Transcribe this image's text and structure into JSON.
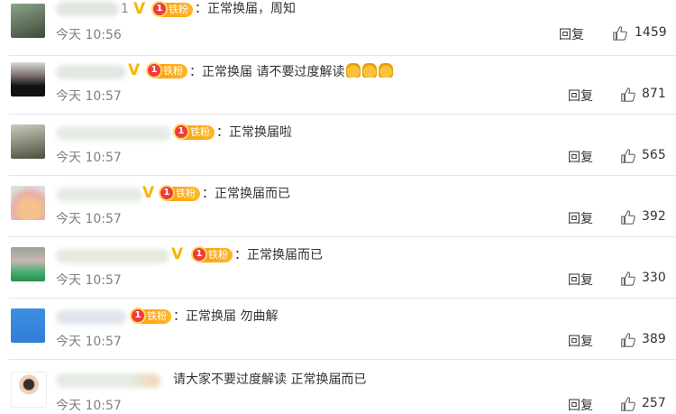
{
  "comments": [
    {
      "text": "：正常换届，周知",
      "time": "今天 10:56",
      "reply": "回复",
      "likes": "1459",
      "fan_badge": "铁粉",
      "level": "1",
      "name_suffix": "1",
      "verified": "V"
    },
    {
      "text": "：正常换届 请不要过度解读",
      "time": "今天 10:57",
      "reply": "回复",
      "likes": "871",
      "fan_badge": "铁粉",
      "level": "1",
      "verified": "V",
      "emoji_count": 3
    },
    {
      "text": "：正常换届啦",
      "time": "今天 10:57",
      "reply": "回复",
      "likes": "565",
      "fan_badge": "铁粉",
      "level": "1"
    },
    {
      "text": "：正常换届而已",
      "time": "今天 10:57",
      "reply": "回复",
      "likes": "392",
      "fan_badge": "铁粉",
      "level": "1",
      "verified": "V"
    },
    {
      "text": "：正常换届而已",
      "time": "今天 10:57",
      "reply": "回复",
      "likes": "330",
      "fan_badge": "铁粉",
      "level": "1",
      "verified": "V"
    },
    {
      "text": "：正常换届 勿曲解",
      "time": "今天 10:57",
      "reply": "回复",
      "likes": "389",
      "fan_badge": "铁粉",
      "level": "1"
    },
    {
      "text": "请大家不要过度解读 正常换届而已",
      "time": "今天 10:57",
      "reply": "回复",
      "likes": "257"
    }
  ],
  "icons": {
    "like": "thumbs-up-icon",
    "emoji": "pray-hands-emoji"
  },
  "colors": {
    "verified": "#f7b500",
    "fan_badge": "#ff9a00",
    "time": "#808080"
  }
}
